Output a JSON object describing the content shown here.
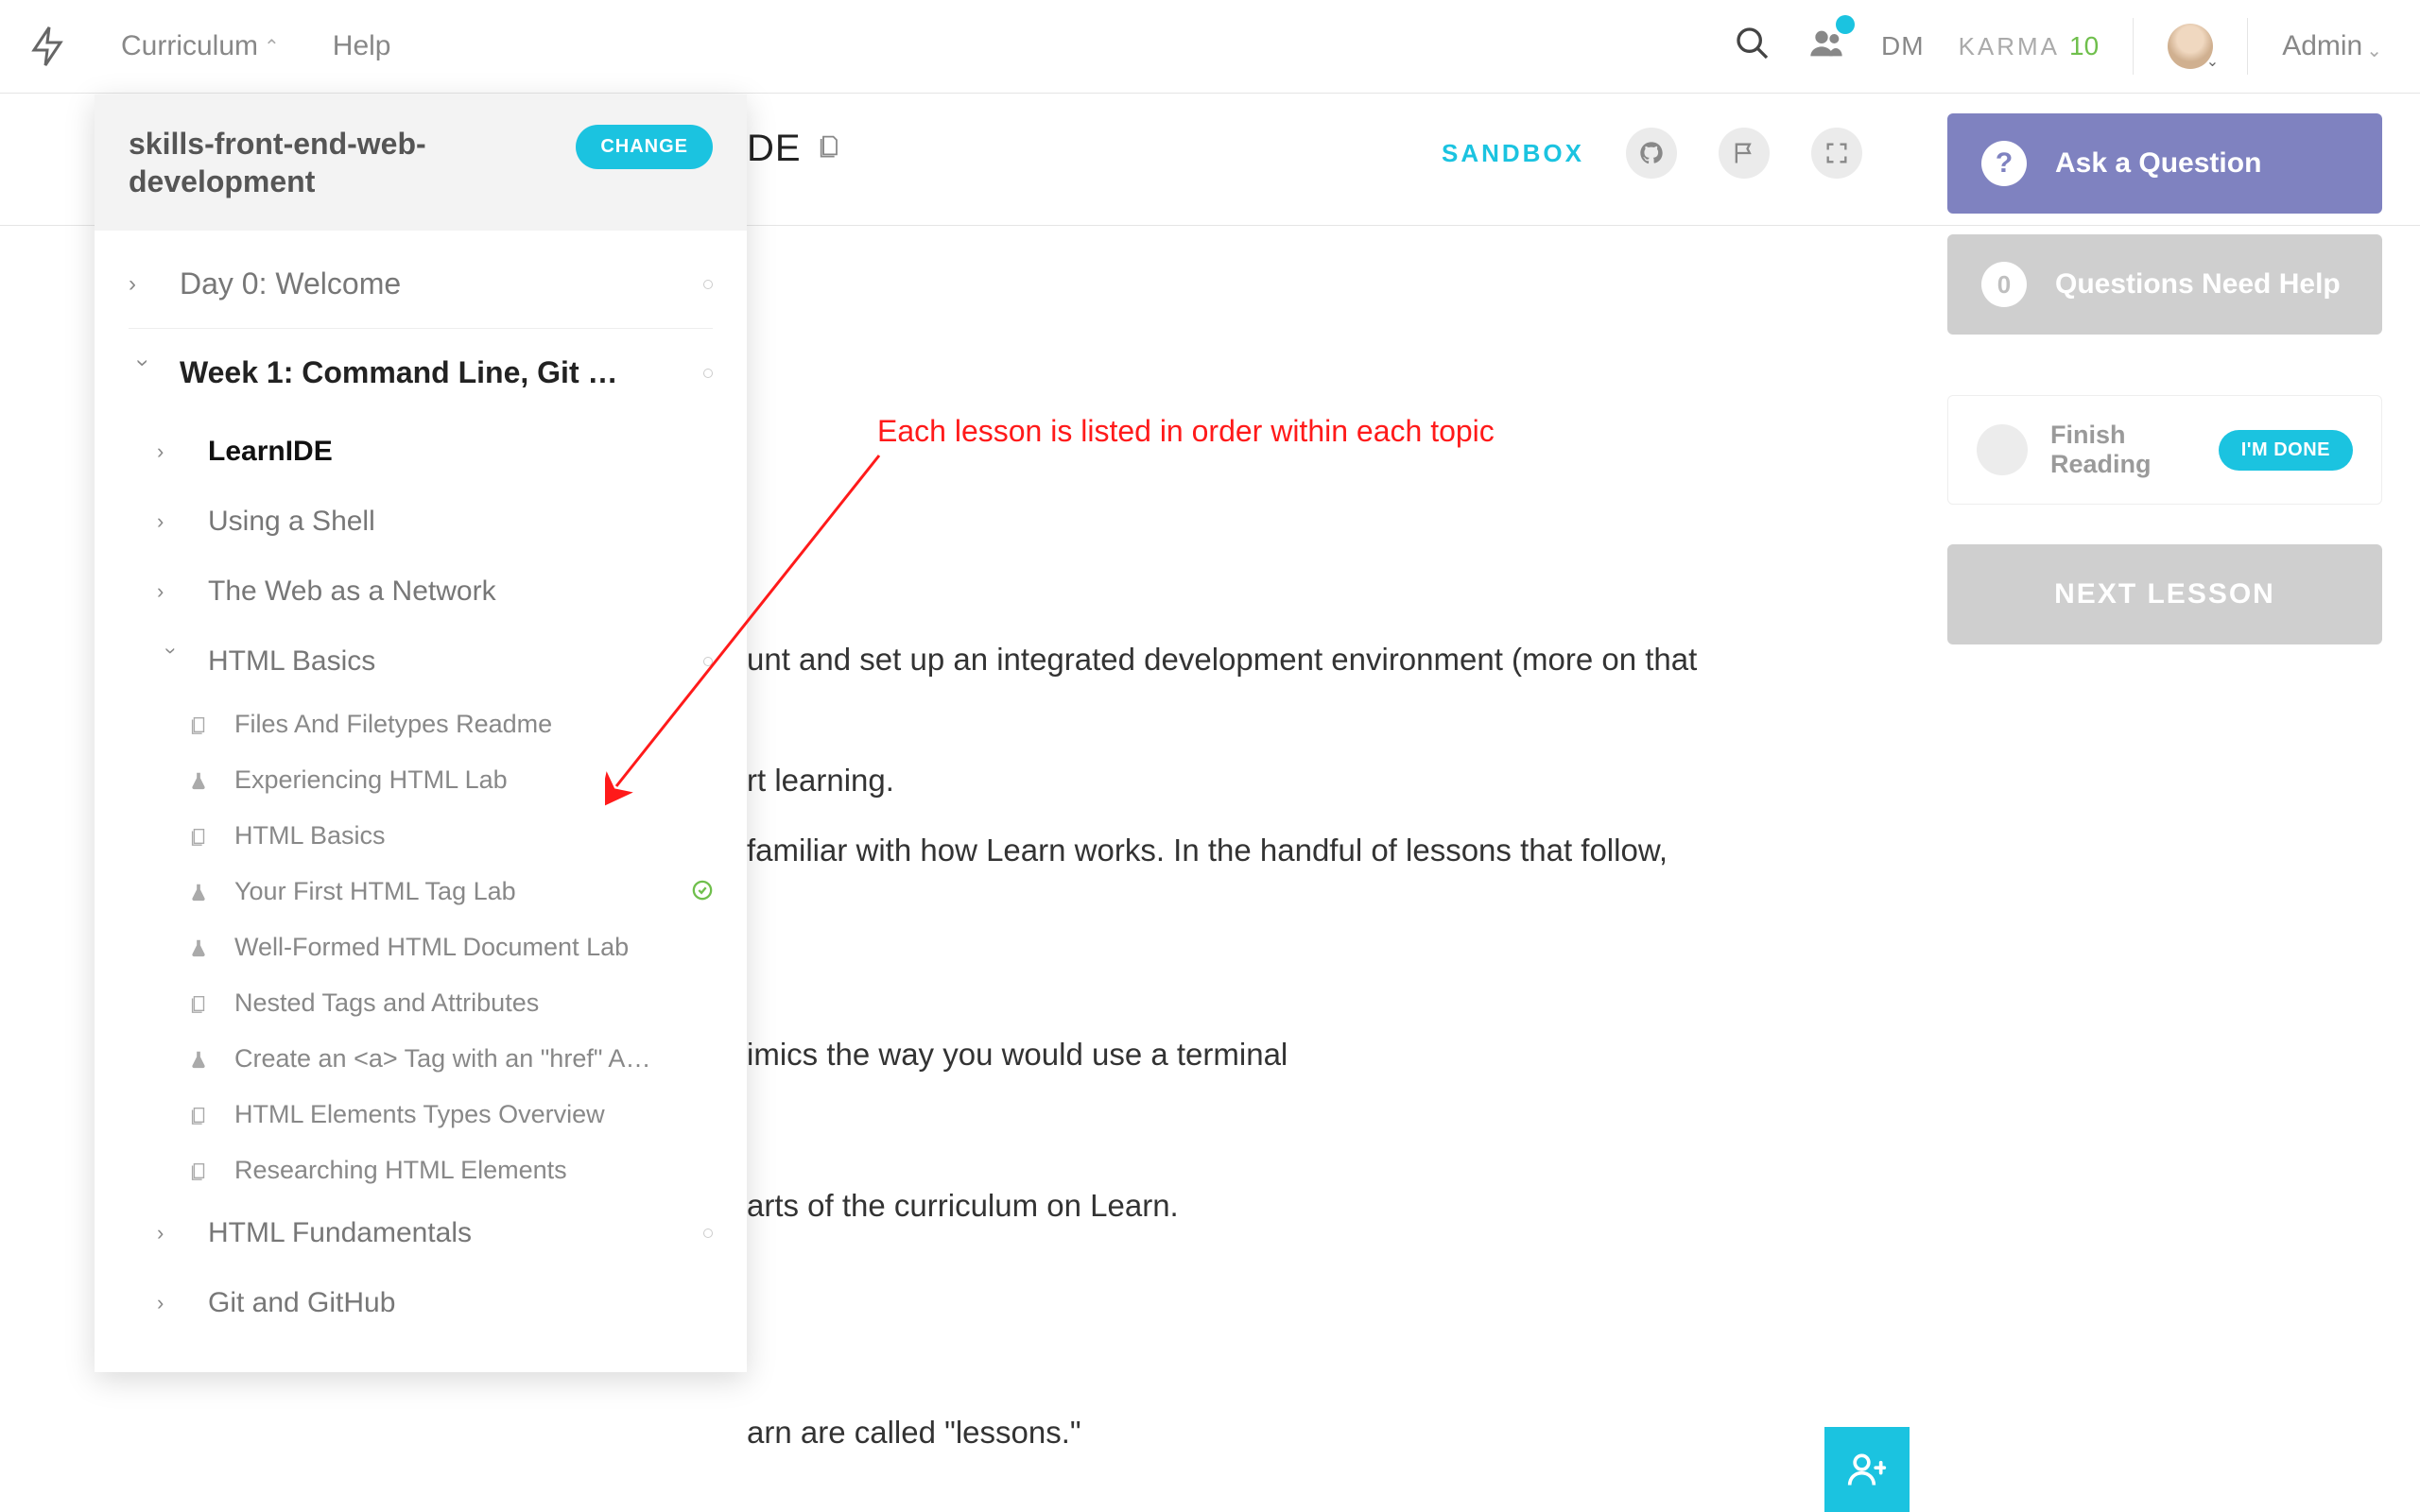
{
  "topnav": {
    "curriculum": "Curriculum",
    "help": "Help",
    "dm": "DM",
    "karma_label": "KARMA",
    "karma_value": "10",
    "admin": "Admin"
  },
  "curriculum_panel": {
    "track": "skills-front-end-web-development",
    "change": "CHANGE",
    "sections": [
      {
        "label": "Day 0: Welcome",
        "expanded": false,
        "bold": false
      },
      {
        "label": "Week 1:  Command Line, Git …",
        "expanded": true,
        "bold": true
      }
    ],
    "topics": [
      {
        "label": "LearnIDE",
        "expanded": false,
        "bold": true
      },
      {
        "label": "Using a Shell",
        "expanded": false,
        "bold": false
      },
      {
        "label": "The Web as a Network",
        "expanded": false,
        "bold": false
      },
      {
        "label": "HTML Basics",
        "expanded": true,
        "bold": false
      }
    ],
    "lessons": [
      {
        "label": "Files And Filetypes Readme",
        "icon": "book"
      },
      {
        "label": "Experiencing HTML Lab",
        "icon": "lab"
      },
      {
        "label": "HTML Basics",
        "icon": "book"
      },
      {
        "label": "Your First HTML Tag Lab",
        "icon": "lab",
        "checked": true
      },
      {
        "label": "Well-Formed HTML Document Lab",
        "icon": "lab"
      },
      {
        "label": "Nested Tags and Attributes",
        "icon": "book"
      },
      {
        "label": "Create an <a> Tag with an \"href\" A…",
        "icon": "lab"
      },
      {
        "label": "HTML Elements Types Overview",
        "icon": "book"
      },
      {
        "label": "Researching HTML Elements",
        "icon": "book"
      }
    ],
    "topics_after": [
      {
        "label": "HTML Fundamentals"
      },
      {
        "label": "Git and GitHub"
      }
    ]
  },
  "page": {
    "title_fragment": "DE",
    "sandbox": "SANDBOX"
  },
  "right": {
    "ask": "Ask a Question",
    "help_count": "0",
    "help_label": "Questions Need Help",
    "finish": "Finish Reading",
    "done": "I'M DONE",
    "next": "NEXT LESSON"
  },
  "body": {
    "l1": "unt and set up an integrated development environment (more on that",
    "l2": "rt learning.",
    "l3": "familiar with how Learn works. In the handful of lessons that follow,",
    "l4": "imics the way you would use a terminal",
    "l5": "arts of the curriculum on Learn.",
    "l6": "arn are called \"lessons.\""
  },
  "annotation": "Each lesson is listed in order within each topic"
}
